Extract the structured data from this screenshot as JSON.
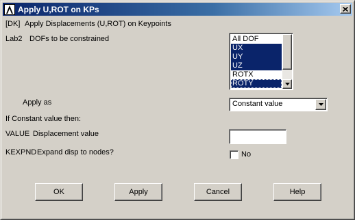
{
  "window": {
    "title": "Apply U,ROT on KPs",
    "close_glyph": "×",
    "app_icon": "ansys-logo-icon"
  },
  "header": {
    "code": "[DK]",
    "description": "Apply Displacements (U,ROT) on Keypoints"
  },
  "lab2": {
    "label": "Lab2",
    "description": "DOFs to be constrained",
    "options": [
      {
        "label": "All DOF",
        "selected": false
      },
      {
        "label": "UX",
        "selected": true
      },
      {
        "label": "UY",
        "selected": true
      },
      {
        "label": "UZ",
        "selected": true
      },
      {
        "label": "ROTX",
        "selected": false
      },
      {
        "label": "ROTY",
        "selected": true
      }
    ]
  },
  "apply_as": {
    "label": "Apply as",
    "selected": "Constant value"
  },
  "constant_note": "If Constant value then:",
  "value_field": {
    "label": "VALUE",
    "description": "Displacement value",
    "value": ""
  },
  "kexpnd": {
    "label": "KEXPND",
    "description": "Expand disp to nodes?",
    "checkbox_label": "No",
    "checked": false
  },
  "buttons": {
    "ok": "OK",
    "apply": "Apply",
    "cancel": "Cancel",
    "help": "Help"
  },
  "colors": {
    "dialog_bg": "#d4d0c8",
    "selection": "#0a246a",
    "title_start": "#0a246a",
    "title_end": "#a6caf0"
  }
}
